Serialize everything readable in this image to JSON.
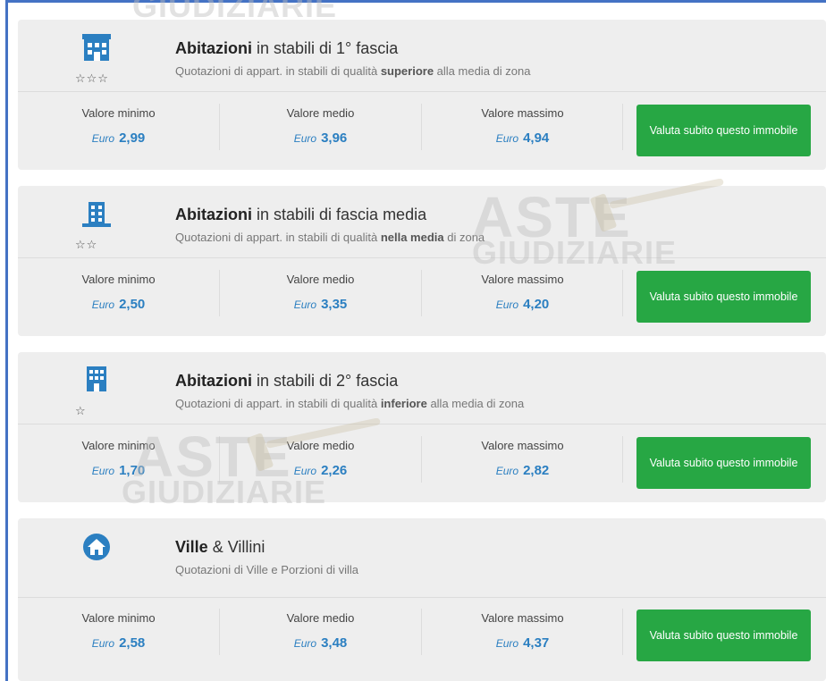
{
  "watermark": {
    "line1": "ASTE",
    "line2": "GIUDIZIARIE",
    "reg": "®"
  },
  "labels": {
    "min": "Valore minimo",
    "avg": "Valore medio",
    "max": "Valore massimo",
    "currency": "Euro"
  },
  "accent_color": "#2b7fc1",
  "button_color": "#27a744",
  "cards": [
    {
      "icon": "building-top-tier-icon",
      "stars": "☆☆☆",
      "title_bold": "Abitazioni",
      "title_rest": " in stabili di 1° fascia",
      "subtitle_pre": "Quotazioni di appart. in stabili di qualità ",
      "subtitle_bold": "superiore",
      "subtitle_post": " alla media di zona",
      "min": "2,99",
      "avg": "3,96",
      "max": "4,94",
      "button": "Valuta subito questo immobile"
    },
    {
      "icon": "building-mid-tier-icon",
      "stars": "☆☆",
      "title_bold": "Abitazioni",
      "title_rest": " in stabili di fascia media",
      "subtitle_pre": "Quotazioni di appart. in stabili di qualità ",
      "subtitle_bold": "nella media",
      "subtitle_post": " di zona",
      "min": "2,50",
      "avg": "3,35",
      "max": "4,20",
      "button": "Valuta subito questo immobile"
    },
    {
      "icon": "building-low-tier-icon",
      "stars": "☆",
      "title_bold": "Abitazioni",
      "title_rest": " in stabili di 2° fascia",
      "subtitle_pre": "Quotazioni di appart. in stabili di qualità ",
      "subtitle_bold": "inferiore",
      "subtitle_post": " alla media di zona",
      "min": "1,70",
      "avg": "2,26",
      "max": "2,82",
      "button": "Valuta subito questo immobile"
    },
    {
      "icon": "villa-icon",
      "stars": "",
      "title_bold": "Ville",
      "title_rest": " & Villini",
      "subtitle_pre": "Quotazioni di Ville e Porzioni di villa",
      "subtitle_bold": "",
      "subtitle_post": "",
      "min": "2,58",
      "avg": "3,48",
      "max": "4,37",
      "button": "Valuta subito questo immobile"
    }
  ]
}
